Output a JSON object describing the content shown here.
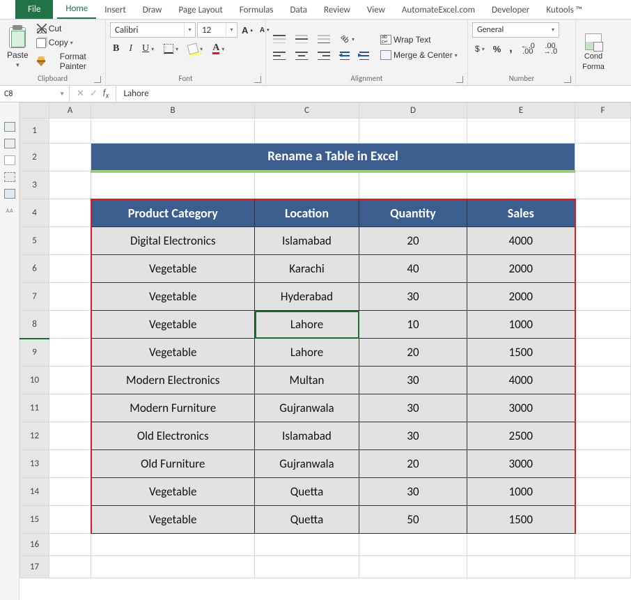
{
  "tabs": {
    "file": "File",
    "items": [
      "Home",
      "Insert",
      "Draw",
      "Page Layout",
      "Formulas",
      "Data",
      "Review",
      "View",
      "AutomateExcel.com",
      "Developer",
      "Kutools ™"
    ],
    "active": "Home"
  },
  "ribbon": {
    "clipboard": {
      "label": "Clipboard",
      "paste": "Paste",
      "cut": "Cut",
      "copy": "Copy",
      "painter": "Format Painter"
    },
    "font": {
      "label": "Font",
      "name": "Calibri",
      "size": "12",
      "grow": "A",
      "shrink": "A",
      "bold": "B",
      "italic": "I",
      "underline": "U",
      "fontcolor": "A"
    },
    "alignment": {
      "label": "Alignment",
      "wrap": "Wrap Text",
      "merge": "Merge & Center",
      "orient": "ab"
    },
    "number": {
      "label": "Number",
      "format": "General",
      "acct": "$",
      "pct": "%",
      "comma": ",",
      "inc_dec": "←.0 .00",
      "dec_dec": ".00 →.0"
    },
    "styles": {
      "cond": "Cond",
      "format": "Forma"
    }
  },
  "formula": {
    "cell": "C8",
    "value": "Lahore"
  },
  "columns": [
    "A",
    "B",
    "C",
    "D",
    "E",
    "F"
  ],
  "title": "Rename a Table in Excel",
  "headers": [
    "Product Category",
    "Location",
    "Quantity",
    "Sales"
  ],
  "rows": [
    {
      "cat": "Digital Electronics",
      "loc": "Islamabad",
      "qty": "20",
      "sales": "4000"
    },
    {
      "cat": "Vegetable",
      "loc": "Karachi",
      "qty": "40",
      "sales": "2000"
    },
    {
      "cat": "Vegetable",
      "loc": "Hyderabad",
      "qty": "30",
      "sales": "2000"
    },
    {
      "cat": "Vegetable",
      "loc": "Lahore",
      "qty": "10",
      "sales": "1000"
    },
    {
      "cat": "Vegetable",
      "loc": "Lahore",
      "qty": "20",
      "sales": "1500"
    },
    {
      "cat": "Modern Electronics",
      "loc": "Multan",
      "qty": "30",
      "sales": "4000"
    },
    {
      "cat": "Modern Furniture",
      "loc": "Gujranwala",
      "qty": "30",
      "sales": "3000"
    },
    {
      "cat": "Old Electronics",
      "loc": "Islamabad",
      "qty": "30",
      "sales": "2500"
    },
    {
      "cat": "Old Furniture",
      "loc": "Gujranwala",
      "qty": "20",
      "sales": "3000"
    },
    {
      "cat": "Vegetable",
      "loc": "Quetta",
      "qty": "30",
      "sales": "1000"
    },
    {
      "cat": "Vegetable",
      "loc": "Quetta",
      "qty": "50",
      "sales": "1500"
    }
  ],
  "selected_row": 8
}
